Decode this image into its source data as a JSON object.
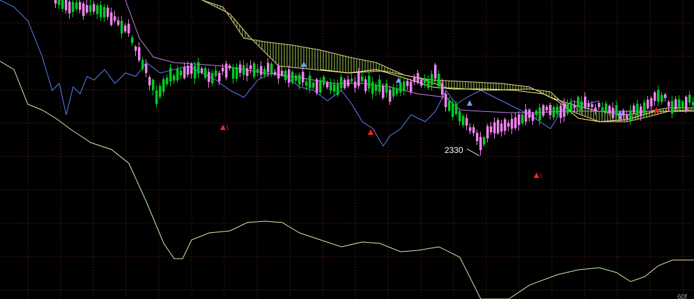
{
  "chart_data": {
    "type": "candlestick",
    "annotation_low": "2330",
    "corner_label": "60f",
    "grid": true,
    "colors": {
      "background": "#000000",
      "grid": "#7a2a2a",
      "candle_up": "#ee82ee",
      "candle_down": "#00cc22",
      "kumo_fill": "#c8ff64",
      "kumo_edge": "#dcd48c",
      "kijun": "#c080e8",
      "chikou": "#5a82ff",
      "tenkan": "#ffff80",
      "lagging_long": "#d8ecb0",
      "signal_buy": "#6fa0ff",
      "signal_sell": "#ff2020"
    },
    "candles_uptrend_frac": 0.55,
    "signals": [
      {
        "type": "sell",
        "label": "\\"
      },
      {
        "type": "sell",
        "label": "\\"
      },
      {
        "type": "sell",
        "label": "\\"
      },
      {
        "type": "sell",
        "label": ""
      },
      {
        "type": "buy",
        "label": ""
      },
      {
        "type": "buy",
        "label": ""
      },
      {
        "type": "buy",
        "label": ""
      },
      {
        "type": "buy",
        "label": ""
      }
    ]
  }
}
